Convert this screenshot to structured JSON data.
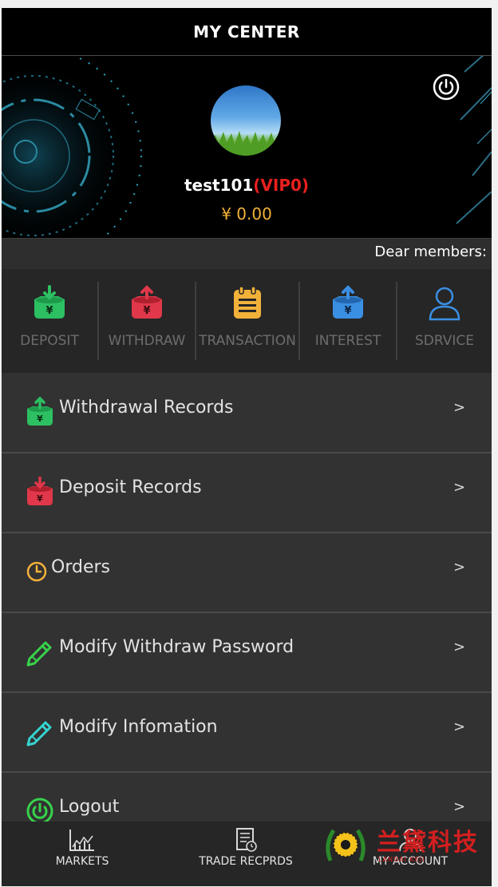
{
  "header": {
    "title": "MY CENTER"
  },
  "profile": {
    "username": "test101",
    "vip": "(VIP0)",
    "balance": "¥ 0.00"
  },
  "notice": {
    "text": "Dear members:"
  },
  "quick_actions": [
    {
      "label": "DEPOSIT",
      "icon": "deposit-icon",
      "color": "#2cc062"
    },
    {
      "label": "WITHDRAW",
      "icon": "withdraw-icon",
      "color": "#e0384a"
    },
    {
      "label": "TRANSACTION",
      "icon": "transaction-icon",
      "color": "#f2b23a"
    },
    {
      "label": "INTEREST",
      "icon": "interest-icon",
      "color": "#3a8fe3"
    },
    {
      "label": "SDRVICE",
      "icon": "user-icon",
      "color": "#3a8fe3"
    }
  ],
  "menu": [
    {
      "label": "Withdrawal Records",
      "icon": "withdraw-icon",
      "color": "#2cc062",
      "arrow": ">"
    },
    {
      "label": "Deposit Records",
      "icon": "deposit-icon",
      "color": "#e0384a",
      "arrow": ">"
    },
    {
      "label": "Orders",
      "icon": "clock-icon",
      "color": "#f2b23a",
      "arrow": ">"
    },
    {
      "label": "Modify Withdraw Password",
      "icon": "pencil-icon",
      "color": "#37d34b",
      "arrow": ">"
    },
    {
      "label": "Modify Infomation",
      "icon": "pencil-icon",
      "color": "#35d5d0",
      "arrow": ">"
    },
    {
      "label": "Logout",
      "icon": "power-icon",
      "color": "#37d34b",
      "arrow": ">"
    }
  ],
  "tabbar": [
    {
      "label": "MARKETS",
      "icon": "chart-icon"
    },
    {
      "label": "TRADE RECPRDS",
      "icon": "document-icon"
    },
    {
      "label": "MY ACCOUNT",
      "icon": "account-icon"
    }
  ],
  "watermark": {
    "text": "兰黛科技",
    "subtext": "LANDAI KEJI"
  }
}
